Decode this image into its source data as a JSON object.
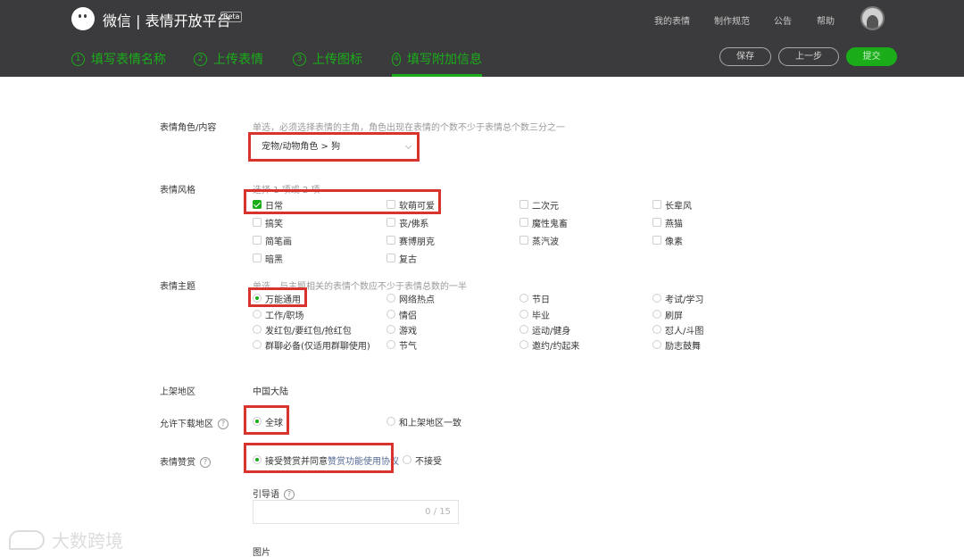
{
  "header": {
    "brand": "微信 | 表情开放平台",
    "beta": "Beta",
    "nav": [
      "我的表情",
      "制作规范",
      "公告",
      "帮助"
    ],
    "steps": [
      {
        "num": "1",
        "label": "填写表情名称"
      },
      {
        "num": "2",
        "label": "上传表情"
      },
      {
        "num": "3",
        "label": "上传图标"
      },
      {
        "num": "4",
        "label": "填写附加信息"
      }
    ],
    "buttons": {
      "save": "保存",
      "prev": "上一步",
      "submit": "提交"
    }
  },
  "form": {
    "role": {
      "label": "表情角色/内容",
      "hint": "单选，必须选择表情的主角，角色出现在表情的个数不少于表情总个数三分之一",
      "value": "宠物/动物角色 > 狗"
    },
    "style": {
      "label": "表情风格",
      "hint": "选择 1 项或 2 项",
      "options": [
        "日常",
        "软萌可爱",
        "二次元",
        "长辈风",
        "搞笑",
        "丧/佛系",
        "魔性鬼畜",
        "燕猫",
        "简笔画",
        "赛博朋克",
        "蒸汽波",
        "像素",
        "暗黑",
        "复古"
      ],
      "checked": [
        "日常"
      ]
    },
    "theme": {
      "label": "表情主题",
      "hint": "单选，与主题相关的表情个数应不少于表情总数的一半",
      "options": [
        "万能通用",
        "网络热点",
        "节日",
        "考试/学习",
        "工作/职场",
        "情侣",
        "毕业",
        "刷屏",
        "发红包/要红包/抢红包",
        "游戏",
        "运动/健身",
        "怼人/斗图",
        "群聊必备(仅适用群聊使用)",
        "节气",
        "邀约/约起来",
        "励志鼓舞"
      ],
      "selected": "万能通用"
    },
    "region": {
      "label": "上架地区",
      "value": "中国大陆"
    },
    "download": {
      "label": "允许下载地区",
      "options": [
        "全球",
        "和上架地区一致"
      ],
      "selected": "全球"
    },
    "reward": {
      "label": "表情赞赏",
      "accept_prefix": "接受赞赏并同意",
      "accept_link": "赞赏功能使用协议",
      "reject": "不接受"
    },
    "guide": {
      "label": "引导语",
      "counter": "0 / 15"
    },
    "image": {
      "label": "图片"
    }
  },
  "watermark": "大数跨境"
}
